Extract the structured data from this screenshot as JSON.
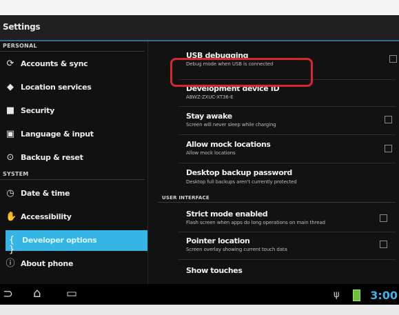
{
  "app": {
    "title": "Settings"
  },
  "left": {
    "sections": [
      {
        "header": "PERSONAL",
        "items": [
          {
            "label": "Accounts & sync",
            "icon": "sync-icon"
          },
          {
            "label": "Location services",
            "icon": "location-icon"
          },
          {
            "label": "Security",
            "icon": "lock-icon"
          },
          {
            "label": "Language & input",
            "icon": "keyboard-icon"
          },
          {
            "label": "Backup & reset",
            "icon": "backup-icon"
          }
        ]
      },
      {
        "header": "SYSTEM",
        "items": [
          {
            "label": "Date & time",
            "icon": "clock-icon"
          },
          {
            "label": "Accessibility",
            "icon": "hand-icon"
          },
          {
            "label": "Developer options",
            "icon": "developer-icon",
            "selected": true
          },
          {
            "label": "About phone",
            "icon": "info-icon"
          }
        ]
      }
    ]
  },
  "right": {
    "prefs": [
      {
        "title": "USB debugging",
        "summary": "Debug mode when USB is connected",
        "checkbox": true
      },
      {
        "title": "Development device ID",
        "summary": "ABWZ-ZXUC-XT36-E",
        "checkbox": false
      },
      {
        "title": "Stay awake",
        "summary": "Screen will never sleep while charging",
        "checkbox": true
      },
      {
        "title": "Allow mock locations",
        "summary": "Allow mock locations",
        "checkbox": true
      },
      {
        "title": "Desktop backup password",
        "summary": "Desktop full backups aren't currently protected",
        "checkbox": false
      }
    ],
    "subheader": "USER INTERFACE",
    "prefs2": [
      {
        "title": "Strict mode enabled",
        "summary": "Flash screen when apps do long operations on main thread",
        "checkbox": true
      },
      {
        "title": "Pointer location",
        "summary": "Screen overlay showing current touch data",
        "checkbox": true
      },
      {
        "title": "Show touches",
        "summary": "",
        "checkbox": true
      }
    ]
  },
  "systembar": {
    "clock": "3:00",
    "nav": [
      "back-icon",
      "home-icon",
      "recents-icon"
    ],
    "status": [
      "usb-icon",
      "battery-icon"
    ]
  },
  "colors": {
    "accent": "#35b5e5",
    "highlight": "#d7282f"
  }
}
